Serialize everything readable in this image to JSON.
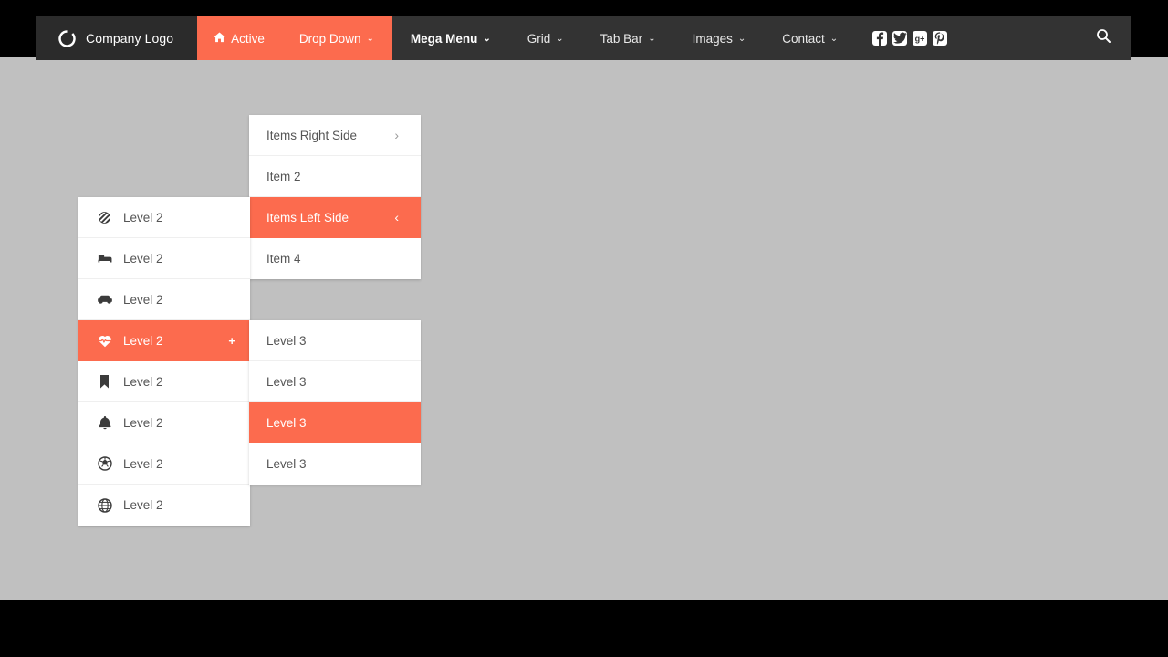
{
  "theme": {
    "accent": "#fc6b4e",
    "navbar_bg": "#333333",
    "brand_bg": "#2b2b2b",
    "page_bg": "#c0c0c0",
    "panel_bg": "#ffffff",
    "text_muted": "#555555"
  },
  "navbar": {
    "brand": {
      "label": "Company Logo",
      "icon": "circle-notch-icon"
    },
    "items": [
      {
        "label": "Active",
        "icon": "home-icon",
        "caret": "",
        "state": "active"
      },
      {
        "label": "Drop Down",
        "icon": "",
        "caret": "⌄",
        "state": "open"
      },
      {
        "label": "Mega Menu",
        "icon": "",
        "caret": "⌄",
        "state": "strong"
      },
      {
        "label": "Grid",
        "icon": "",
        "caret": "⌄",
        "state": "normal"
      },
      {
        "label": "Tab Bar",
        "icon": "",
        "caret": "⌄",
        "state": "normal"
      },
      {
        "label": "Images",
        "icon": "",
        "caret": "⌄",
        "state": "normal"
      },
      {
        "label": "Contact",
        "icon": "",
        "caret": "⌄",
        "state": "normal"
      }
    ],
    "social": [
      {
        "name": "facebook-icon",
        "glyph": "f"
      },
      {
        "name": "twitter-icon",
        "glyph": "t"
      },
      {
        "name": "google-plus-icon",
        "glyph": "g"
      },
      {
        "name": "pinterest-icon",
        "glyph": "p"
      }
    ],
    "search": {
      "icon": "search-icon",
      "label": "Search"
    }
  },
  "dropdown_top": {
    "items": [
      {
        "label": "Items Right Side",
        "arrow": "›",
        "highlighted": false
      },
      {
        "label": "Item 2",
        "arrow": "",
        "highlighted": false
      },
      {
        "label": "Items Left Side",
        "arrow": "‹",
        "highlighted": true
      },
      {
        "label": "Item 4",
        "arrow": "",
        "highlighted": false
      }
    ]
  },
  "dropdown_left": {
    "items": [
      {
        "label": "Level 2",
        "icon": "beer-icon",
        "badge": "",
        "highlighted": false
      },
      {
        "label": "Level 2",
        "icon": "bed-icon",
        "badge": "",
        "highlighted": false
      },
      {
        "label": "Level 2",
        "icon": "car-icon",
        "badge": "",
        "highlighted": false
      },
      {
        "label": "Level 2",
        "icon": "heartbeat-icon",
        "badge": "+",
        "highlighted": true
      },
      {
        "label": "Level 2",
        "icon": "bookmark-icon",
        "badge": "",
        "highlighted": false
      },
      {
        "label": "Level 2",
        "icon": "bell-icon",
        "badge": "",
        "highlighted": false
      },
      {
        "label": "Level 2",
        "icon": "soccer-ball-icon",
        "badge": "",
        "highlighted": false
      },
      {
        "label": "Level 2",
        "icon": "globe-icon",
        "badge": "",
        "highlighted": false
      }
    ]
  },
  "dropdown_level3": {
    "items": [
      {
        "label": "Level 3",
        "highlighted": false
      },
      {
        "label": "Level 3",
        "highlighted": false
      },
      {
        "label": "Level 3",
        "highlighted": true
      },
      {
        "label": "Level 3",
        "highlighted": false
      }
    ]
  }
}
